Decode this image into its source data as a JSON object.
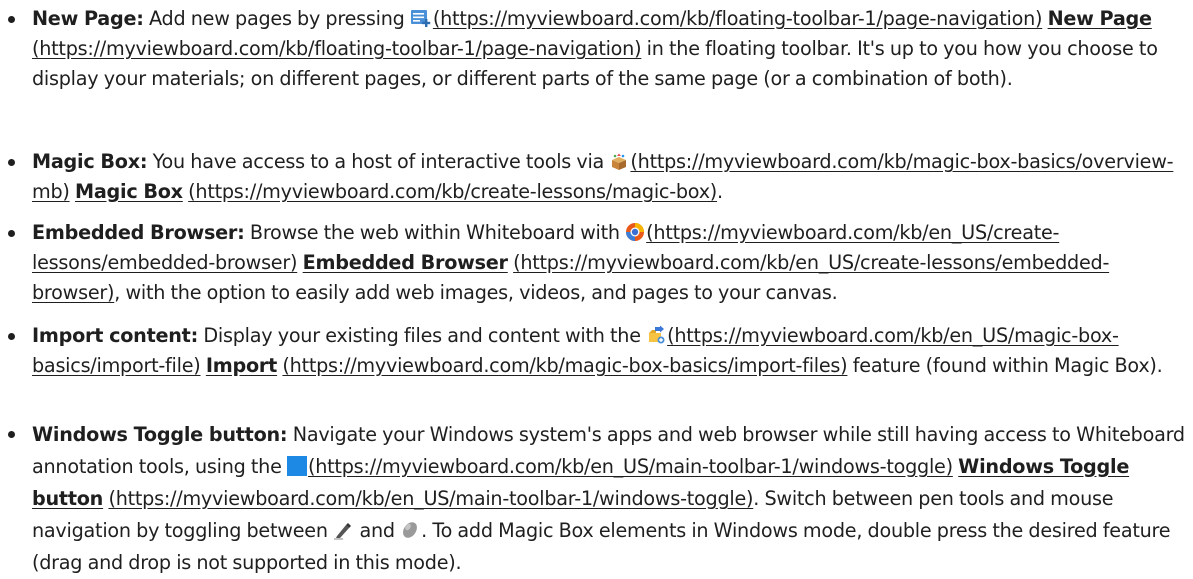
{
  "items": [
    {
      "title": "New Page:",
      "text1": "Add new pages by pressing",
      "link1": "(https://myviewboard.com/kb/floating-toolbar-1/page-navigation)",
      "strong_link": "New Page",
      "link2": "(https://myviewboard.com/kb/floating-toolbar-1/page-navigation)",
      "text2": "in the floating toolbar. It's up to you how you choose to display your materials; on different pages, or different parts of the same page (or a combination of both).",
      "icon": "new-page-icon"
    },
    {
      "title": "Magic Box:",
      "text1": "You have access to a host of interactive tools via",
      "link1": "(https://myviewboard.com/kb/magic-box-basics/overview-mb)",
      "strong_link": "Magic Box",
      "link2": "(https://myviewboard.com/kb/create-lessons/magic-box)",
      "text2": ".",
      "icon": "magic-box-icon"
    },
    {
      "title": "Embedded Browser:",
      "text1": "Browse the web within Whiteboard with",
      "link1": "(https://myviewboard.com/kb/en_US/create-lessons/embedded-browser)",
      "strong_link": "Embedded Browser",
      "link2": "(https://myviewboard.com/kb/en_US/create-lessons/embedded-browser)",
      "text2": ", with the option to easily add web images, videos, and pages to your canvas.",
      "icon": "browser-icon"
    },
    {
      "title": "Import content:",
      "text1": "Display your existing files and content with the",
      "link1": "(https://myviewboard.com/kb/en_US/magic-box-basics/import-file)",
      "strong_link": "Import",
      "link2": "(https://myviewboard.com/kb/magic-box-basics/import-files)",
      "text2": "feature (found within Magic Box).",
      "icon": "import-icon"
    },
    {
      "title": "Windows Toggle button:",
      "text1": "Navigate your Windows system's apps and web browser while still having access to Whiteboard annotation tools, using the",
      "link1": "(https://myviewboard.com/kb/en_US/main-toolbar-1/windows-toggle)",
      "strong_link": "Windows Toggle button",
      "link2": "(https://myviewboard.com/kb/en_US/main-toolbar-1/windows-toggle)",
      "text2": ". Switch between pen tools and mouse navigation by toggling between",
      "text3": "and",
      "text4": ". To add Magic Box elements in Windows mode, double press the desired feature (drag and drop is not supported in this mode).",
      "icon": "windows-toggle-icon",
      "icon_pen": "pen-icon",
      "icon_mouse": "mouse-icon"
    }
  ],
  "colors": {
    "text": "#1f1f1f",
    "windows_blue": "#1e88e5",
    "new_page_blue": "#4a90d9"
  }
}
